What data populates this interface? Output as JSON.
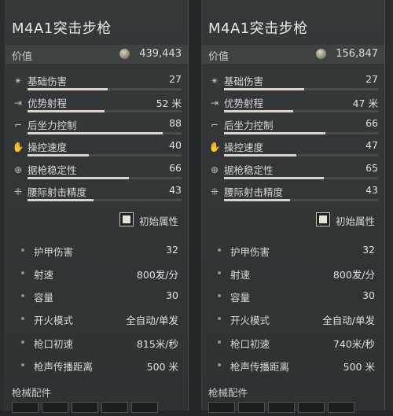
{
  "panels": [
    {
      "title": "M4A1突击步枪",
      "value_label": "价值",
      "value": "439,443",
      "stats": [
        {
          "icon": "damage-icon",
          "label": "基础伤害",
          "value": "27",
          "fill": 0.52
        },
        {
          "icon": "range-icon",
          "label": "优势射程",
          "value": "52 米",
          "fill": 0.5
        },
        {
          "icon": "recoil-icon",
          "label": "后坐力控制",
          "value": "88",
          "fill": 0.88
        },
        {
          "icon": "handling-icon",
          "label": "操控速度",
          "value": "40",
          "fill": 0.4
        },
        {
          "icon": "crosshair-icon",
          "label": "据枪稳定性",
          "value": "66",
          "fill": 0.66
        },
        {
          "icon": "hipfire-icon",
          "label": "腰际射击精度",
          "value": "43",
          "fill": 0.43
        }
      ],
      "init_label": "初始属性",
      "attributes": [
        {
          "label": "护甲伤害",
          "value": "32"
        },
        {
          "label": "射速",
          "value": "800发/分"
        },
        {
          "label": "容量",
          "value": "30"
        },
        {
          "label": "开火模式",
          "value": "全自动/单发"
        },
        {
          "label": "枪口初速",
          "value": "815米/秒"
        },
        {
          "label": "枪声传播距离",
          "value": "500 米"
        }
      ],
      "section_title": "枪械配件"
    },
    {
      "title": "M4A1突击步枪",
      "value_label": "价值",
      "value": "156,847",
      "stats": [
        {
          "icon": "damage-icon",
          "label": "基础伤害",
          "value": "27",
          "fill": 0.52
        },
        {
          "icon": "range-icon",
          "label": "优势射程",
          "value": "47 米",
          "fill": 0.45
        },
        {
          "icon": "recoil-icon",
          "label": "后坐力控制",
          "value": "66",
          "fill": 0.66
        },
        {
          "icon": "handling-icon",
          "label": "操控速度",
          "value": "47",
          "fill": 0.47
        },
        {
          "icon": "crosshair-icon",
          "label": "据枪稳定性",
          "value": "65",
          "fill": 0.65
        },
        {
          "icon": "hipfire-icon",
          "label": "腰际射击精度",
          "value": "43",
          "fill": 0.43
        }
      ],
      "init_label": "初始属性",
      "attributes": [
        {
          "label": "护甲伤害",
          "value": "32"
        },
        {
          "label": "射速",
          "value": "800发/分"
        },
        {
          "label": "容量",
          "value": "30"
        },
        {
          "label": "开火模式",
          "value": "全自动/单发"
        },
        {
          "label": "枪口初速",
          "value": "740米/秒"
        },
        {
          "label": "枪声传播距离",
          "value": "500 米"
        }
      ],
      "section_title": "枪械配件"
    }
  ],
  "colors": {
    "accent": "#d8d6cc",
    "panel_bg": "#33373 8",
    "text": "#d6d8d4"
  }
}
